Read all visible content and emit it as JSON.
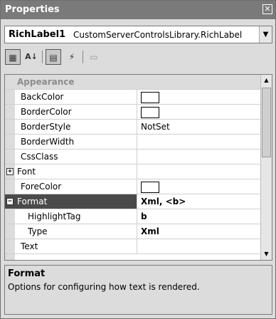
{
  "window": {
    "title": "Properties",
    "close_glyph": "✕"
  },
  "object_selector": {
    "name": "RichLabel1",
    "type": "CustomServerControlsLibrary.RichLabel"
  },
  "toolbar": {
    "buttons": [
      {
        "icon": "categorized-icon",
        "glyph": "▦"
      },
      {
        "icon": "alphabetical-icon",
        "glyph": "A↓"
      },
      {
        "icon": "properties-icon",
        "glyph": "▤"
      },
      {
        "icon": "events-icon",
        "glyph": "⚡"
      },
      {
        "icon": "property-pages-icon",
        "glyph": "▭"
      }
    ]
  },
  "grid": {
    "category": "Appearance",
    "rows": [
      {
        "name": "BackColor",
        "value": "",
        "swatch": true
      },
      {
        "name": "BorderColor",
        "value": "",
        "swatch": true
      },
      {
        "name": "BorderStyle",
        "value": "NotSet"
      },
      {
        "name": "BorderWidth",
        "value": ""
      },
      {
        "name": "CssClass",
        "value": ""
      },
      {
        "name": "Font",
        "value": "",
        "expander": "+"
      },
      {
        "name": "ForeColor",
        "value": "",
        "swatch": true
      },
      {
        "name": "Format",
        "value": "Xml, <b>",
        "expander": "−",
        "selected": true,
        "bold_value": true
      },
      {
        "name": "HighlightTag",
        "value": "b",
        "indent": true,
        "bold_value": true
      },
      {
        "name": "Type",
        "value": "Xml",
        "indent": true,
        "bold_value": true
      },
      {
        "name": "Text",
        "value": ""
      }
    ]
  },
  "description": {
    "title": "Format",
    "text": "Options for configuring how text is rendered."
  },
  "colors": {
    "title_bar": "#7a7a7a",
    "selected_row": "#4a4a4a"
  }
}
